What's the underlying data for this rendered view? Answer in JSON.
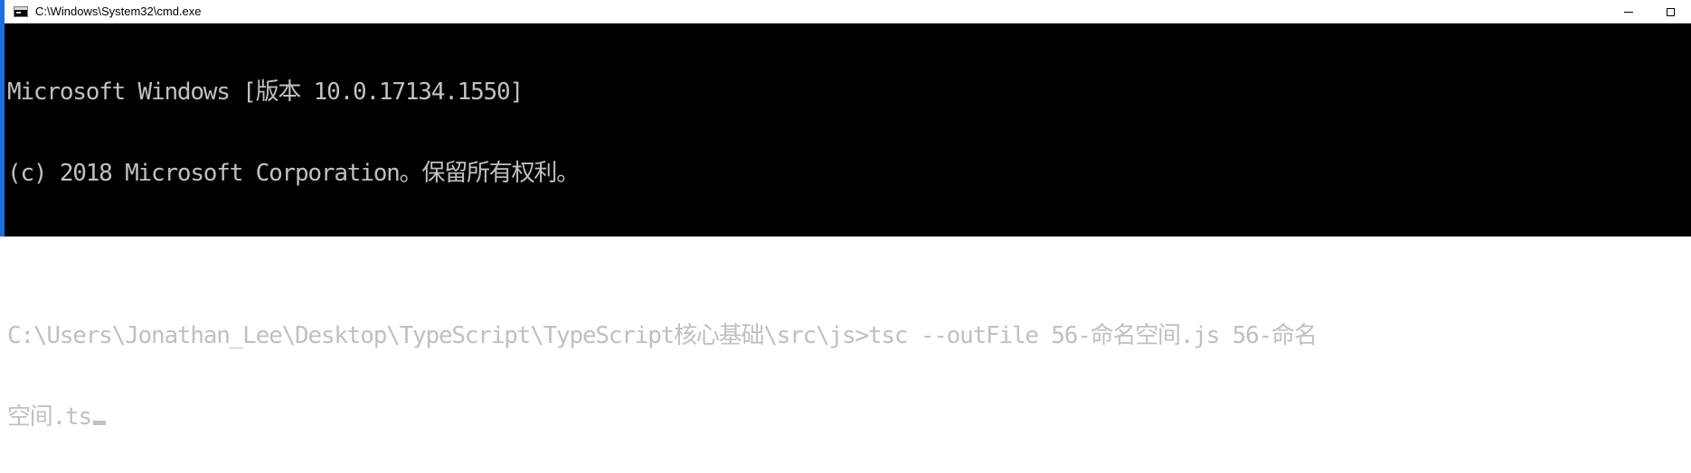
{
  "window": {
    "title": "C:\\Windows\\System32\\cmd.exe",
    "icon": "cmd-icon",
    "controls": [
      "minimize-icon",
      "maximize-icon"
    ]
  },
  "console": {
    "lines": [
      "Microsoft Windows [版本 10.0.17134.1550]",
      "(c) 2018 Microsoft Corporation。保留所有权利。",
      "",
      "C:\\Users\\Jonathan_Lee\\Desktop\\TypeScript\\TypeScript核心基础\\src\\js>tsc --outFile 56-命名空间.js 56-命名",
      "空间.ts"
    ]
  },
  "colors": {
    "console_bg": "#000000",
    "console_text": "#c0c0c0",
    "titlebar_bg": "#ffffff",
    "accent_edge": "#1e6fd9"
  }
}
